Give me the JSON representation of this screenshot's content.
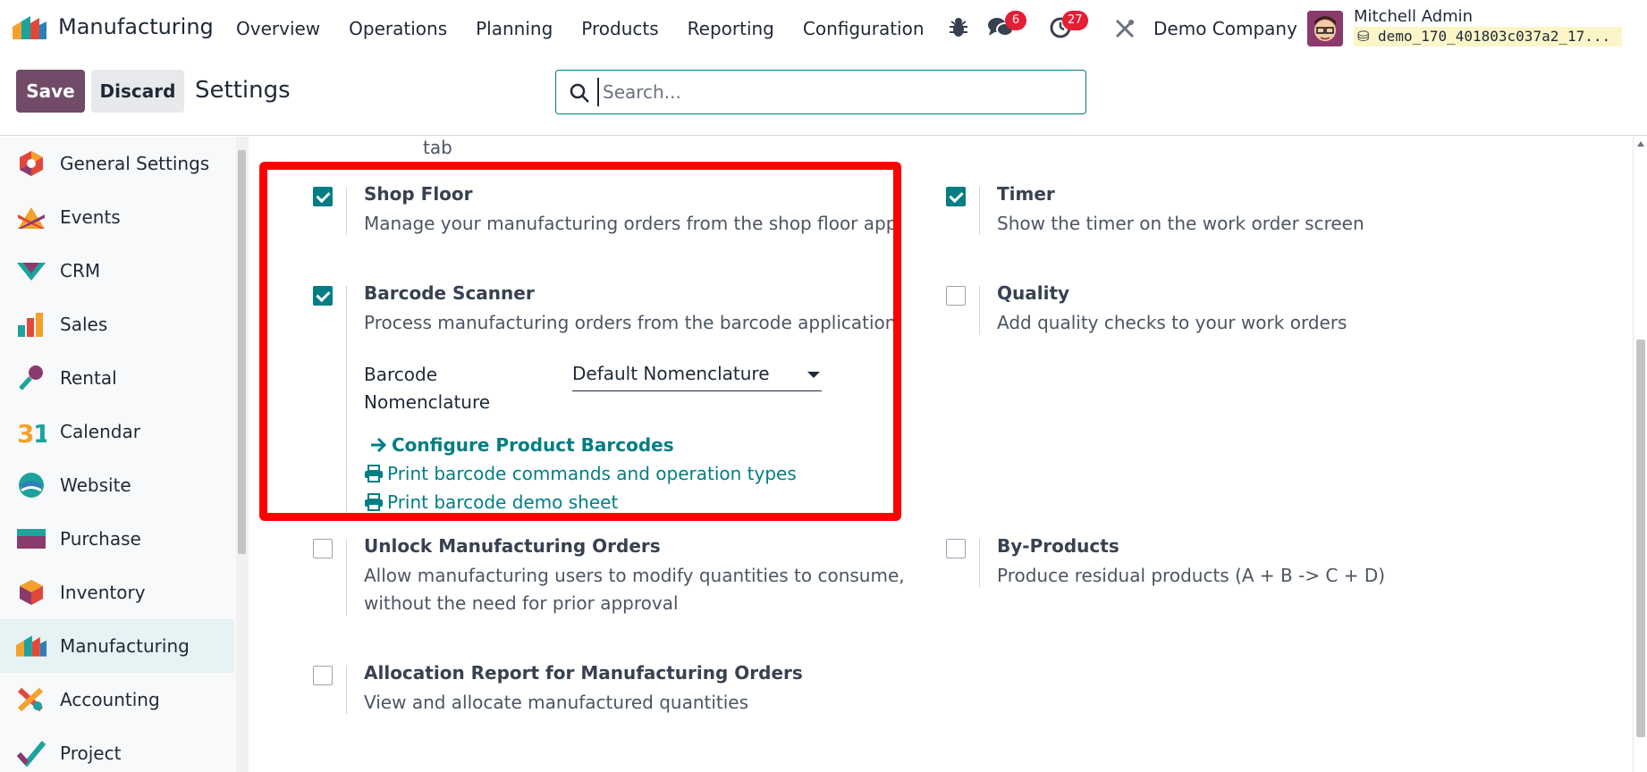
{
  "navbar": {
    "app_name": "Manufacturing",
    "menu": [
      "Overview",
      "Operations",
      "Planning",
      "Products",
      "Reporting",
      "Configuration"
    ],
    "messages_count": "6",
    "activities_count": "27",
    "company": "Demo Company",
    "user_name": "Mitchell Admin",
    "db_name": "demo_170_401803c037a2_17..."
  },
  "control": {
    "save_label": "Save",
    "discard_label": "Discard",
    "title": "Settings",
    "search_placeholder": "Search..."
  },
  "sidebar": {
    "items": [
      {
        "label": "General Settings",
        "icon": "general-settings-icon"
      },
      {
        "label": "Events",
        "icon": "events-icon"
      },
      {
        "label": "CRM",
        "icon": "crm-icon"
      },
      {
        "label": "Sales",
        "icon": "sales-icon"
      },
      {
        "label": "Rental",
        "icon": "rental-icon"
      },
      {
        "label": "Calendar",
        "icon": "calendar-icon"
      },
      {
        "label": "Website",
        "icon": "website-icon"
      },
      {
        "label": "Purchase",
        "icon": "purchase-icon"
      },
      {
        "label": "Inventory",
        "icon": "inventory-icon"
      },
      {
        "label": "Manufacturing",
        "icon": "manufacturing-icon",
        "active": true
      },
      {
        "label": "Accounting",
        "icon": "accounting-icon"
      },
      {
        "label": "Project",
        "icon": "project-icon"
      }
    ]
  },
  "main": {
    "tab_text": "tab",
    "shop_floor": {
      "title": "Shop Floor",
      "desc": "Manage your manufacturing orders from the shop floor app",
      "checked": true
    },
    "timer": {
      "title": "Timer",
      "desc": "Show the timer on the work order screen",
      "checked": true
    },
    "barcode_scanner": {
      "title": "Barcode Scanner",
      "desc": "Process manufacturing orders from the barcode application",
      "checked": true,
      "nomenclature_label_1": "Barcode",
      "nomenclature_label_2": "Nomenclature",
      "nomenclature_value": "Default Nomenclature",
      "configure_link": "Configure Product Barcodes",
      "print_commands_link": "Print barcode commands and operation types",
      "print_demo_link": "Print barcode demo sheet"
    },
    "quality": {
      "title": "Quality",
      "desc": "Add quality checks to your work orders",
      "checked": false
    },
    "unlock_mo": {
      "title": "Unlock Manufacturing Orders",
      "desc_1": "Allow manufacturing users to modify quantities to consume,",
      "desc_2": "without the need for prior approval",
      "checked": false
    },
    "by_products": {
      "title": "By-Products",
      "desc": "Produce residual products (A + B -> C + D)",
      "checked": false
    },
    "allocation": {
      "title": "Allocation Report for Manufacturing Orders",
      "desc": "View and allocate manufactured quantities",
      "checked": false
    }
  },
  "colors": {
    "primary": "#714b67",
    "accent": "#017e84",
    "highlight": "#ff0000",
    "badge": "#e31e35"
  }
}
